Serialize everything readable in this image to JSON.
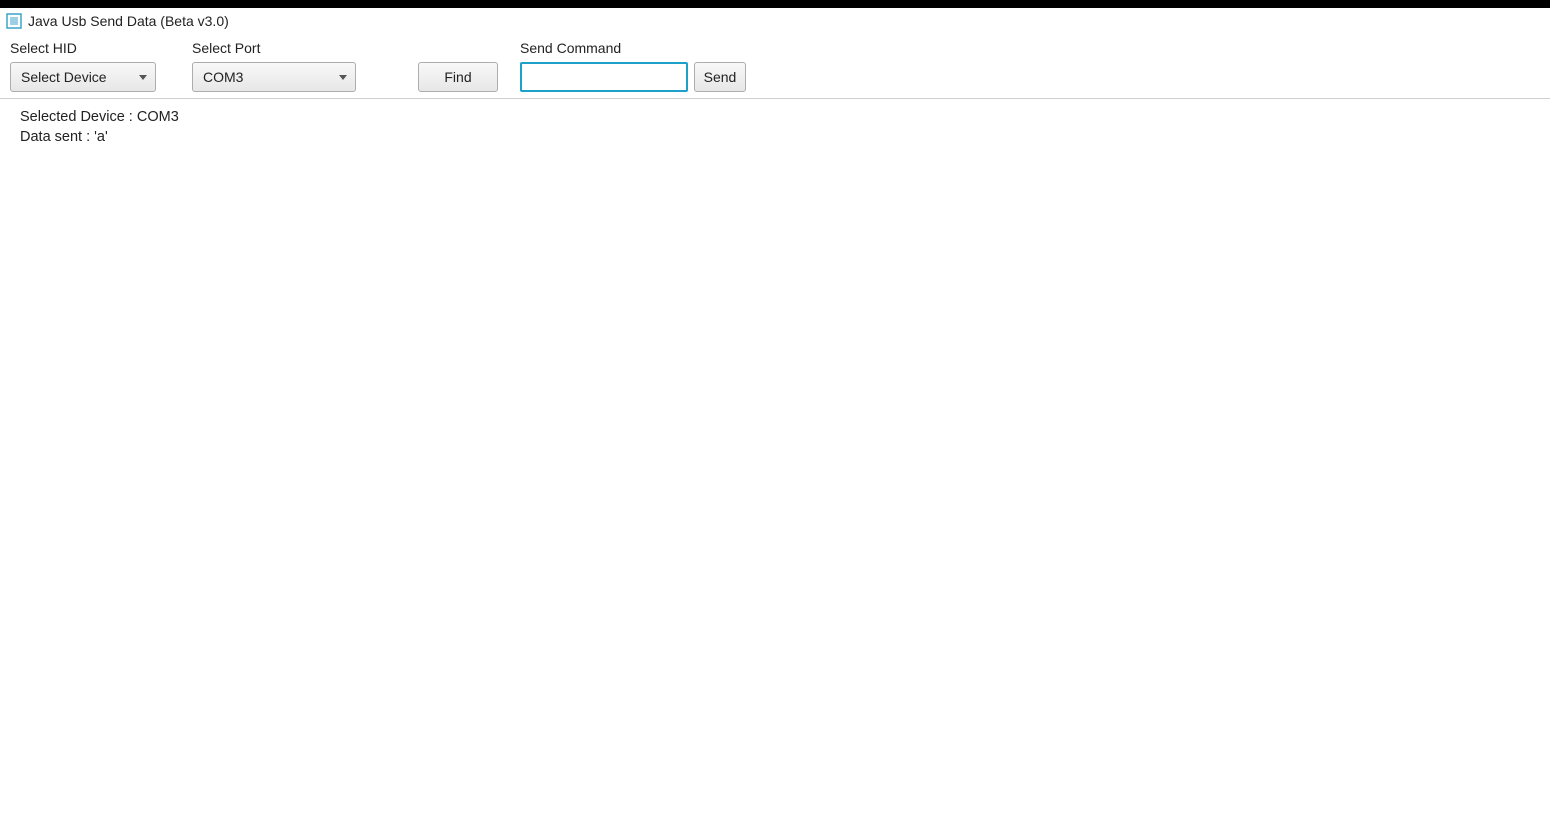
{
  "window": {
    "title": "Java Usb Send Data (Beta v3.0)"
  },
  "labels": {
    "select_hid": "Select HID",
    "select_port": "Select Port",
    "send_command": "Send Command"
  },
  "controls": {
    "hid_selected": "Select Device",
    "port_selected": "COM3",
    "find_label": "Find",
    "command_value": "",
    "send_label": "Send"
  },
  "log": {
    "lines": [
      "Selected Device : COM3",
      "Data sent : 'a'"
    ]
  }
}
